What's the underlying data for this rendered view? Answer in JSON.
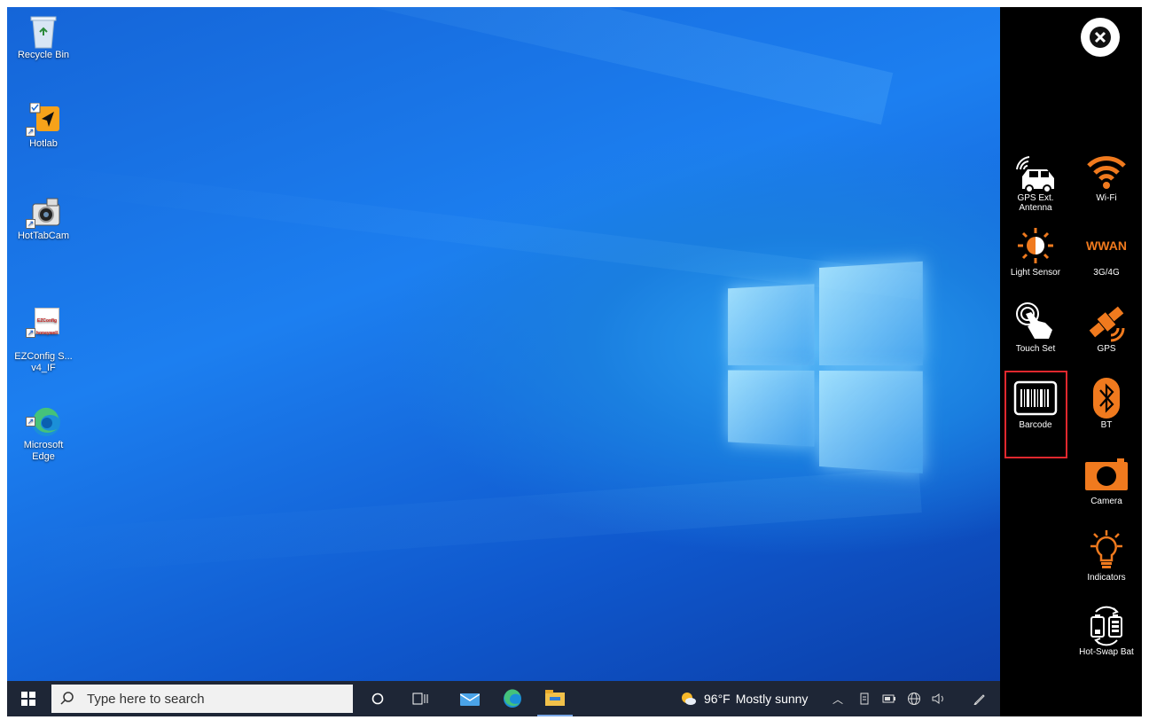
{
  "desktop": {
    "icons": [
      {
        "label": "Recycle Bin"
      },
      {
        "label": "Hotlab"
      },
      {
        "label": "HotTabCam"
      },
      {
        "label": "EZConfig S...\nv4_IF",
        "badge_top": "EZConfig",
        "badge_bottom": "honeywell"
      },
      {
        "label": "Microsoft\nEdge"
      }
    ]
  },
  "taskbar": {
    "search_placeholder": "Type here to search",
    "weather": {
      "temp": "96°F",
      "condition": "Mostly sunny"
    },
    "icons": [
      "windows-start-icon",
      "search-icon",
      "cortana-circle-icon",
      "task-view-icon",
      "mail-icon",
      "edge-icon",
      "file-explorer-icon"
    ],
    "tray_icons": [
      "chevron-up-icon",
      "tablet-icon",
      "battery-icon",
      "network-icon",
      "volume-icon",
      "pen-icon"
    ]
  },
  "panel": {
    "accent": "#f07a1e",
    "tiles": [
      {
        "label": "GPS Ext.\nAntenna",
        "icon": "gps-antenna-car-icon"
      },
      {
        "label": "Wi-Fi",
        "icon": "wifi-icon"
      },
      {
        "label": "Light Sensor",
        "icon": "light-sensor-icon"
      },
      {
        "label": "3G/4G",
        "icon": "wwan-icon",
        "icon_text": "WWAN"
      },
      {
        "label": "Touch Set",
        "icon": "touch-hand-icon"
      },
      {
        "label": "GPS",
        "icon": "satellite-icon"
      },
      {
        "label": "Barcode",
        "icon": "barcode-icon",
        "selected": true
      },
      {
        "label": "BT",
        "icon": "bluetooth-icon"
      },
      {
        "label": "Camera",
        "icon": "camera-icon"
      },
      {
        "label": "Indicators",
        "icon": "lightbulb-icon"
      },
      {
        "label": "Hot-Swap Bat",
        "icon": "hot-swap-battery-icon"
      }
    ]
  }
}
